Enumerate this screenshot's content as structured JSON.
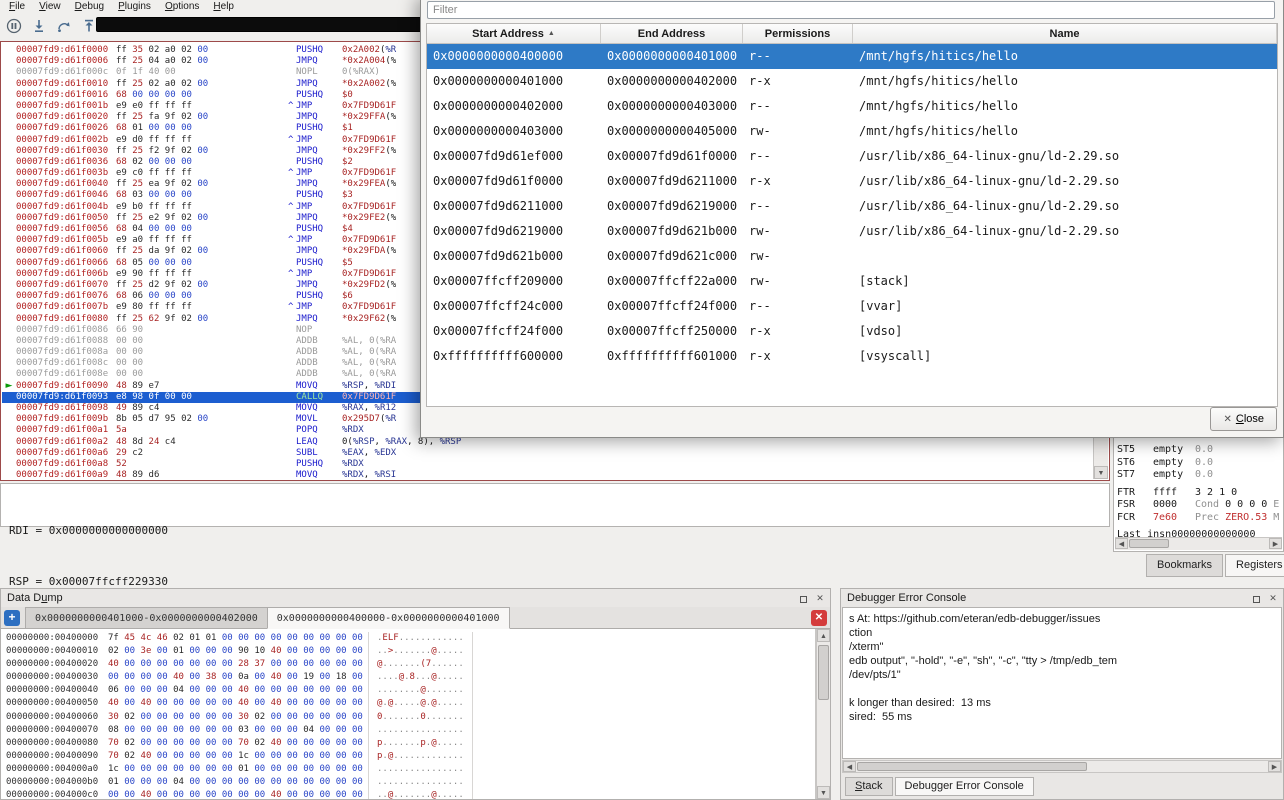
{
  "menu": {
    "items": [
      {
        "label": "File",
        "accel": 0
      },
      {
        "label": "View",
        "accel": 0
      },
      {
        "label": "Debug",
        "accel": 0
      },
      {
        "label": "Plugins",
        "accel": 0
      },
      {
        "label": "Options",
        "accel": 0
      },
      {
        "label": "Help",
        "accel": 0
      }
    ]
  },
  "toolbar": {
    "buttons": [
      {
        "icon": "pause-icon"
      },
      {
        "icon": "step-into-icon"
      },
      {
        "icon": "step-over-icon"
      },
      {
        "icon": "step-out-icon"
      },
      {
        "icon": "run-icon"
      }
    ],
    "args_value": ""
  },
  "disassembly": {
    "rows": [
      [
        "00007fd9:d61f0000",
        "ff 35 02 a0 02 00",
        0,
        "PUSHQ",
        "0x2A002(%R",
        ""
      ],
      [
        "00007fd9:d61f0006",
        "ff 25 04 a0 02 00",
        0,
        "JMPQ",
        "*0x2A004(%",
        ""
      ],
      [
        "00007fd9:d61f000c",
        "0f 1f 40 00",
        0,
        "NOPL",
        "0(%RAX)",
        "gray"
      ],
      [
        "00007fd9:d61f0010",
        "ff 25 02 a0 02 00",
        0,
        "JMPQ",
        "*0x2A002(%",
        ""
      ],
      [
        "00007fd9:d61f0016",
        "68 00 00 00 00",
        0,
        "PUSHQ",
        "$0",
        ""
      ],
      [
        "00007fd9:d61f001b",
        "e9 e0 ff ff ff",
        1,
        "JMP",
        "0x7FD9D61F",
        ""
      ],
      [
        "00007fd9:d61f0020",
        "ff 25 fa 9f 02 00",
        0,
        "JMPQ",
        "*0x29FFA(%",
        ""
      ],
      [
        "00007fd9:d61f0026",
        "68 01 00 00 00",
        0,
        "PUSHQ",
        "$1",
        ""
      ],
      [
        "00007fd9:d61f002b",
        "e9 d0 ff ff ff",
        1,
        "JMP",
        "0x7FD9D61F",
        ""
      ],
      [
        "00007fd9:d61f0030",
        "ff 25 f2 9f 02 00",
        0,
        "JMPQ",
        "*0x29FF2(%",
        ""
      ],
      [
        "00007fd9:d61f0036",
        "68 02 00 00 00",
        0,
        "PUSHQ",
        "$2",
        ""
      ],
      [
        "00007fd9:d61f003b",
        "e9 c0 ff ff ff",
        1,
        "JMP",
        "0x7FD9D61F",
        ""
      ],
      [
        "00007fd9:d61f0040",
        "ff 25 ea 9f 02 00",
        0,
        "JMPQ",
        "*0x29FEA(%",
        ""
      ],
      [
        "00007fd9:d61f0046",
        "68 03 00 00 00",
        0,
        "PUSHQ",
        "$3",
        ""
      ],
      [
        "00007fd9:d61f004b",
        "e9 b0 ff ff ff",
        1,
        "JMP",
        "0x7FD9D61F",
        ""
      ],
      [
        "00007fd9:d61f0050",
        "ff 25 e2 9f 02 00",
        0,
        "JMPQ",
        "*0x29FE2(%",
        ""
      ],
      [
        "00007fd9:d61f0056",
        "68 04 00 00 00",
        0,
        "PUSHQ",
        "$4",
        ""
      ],
      [
        "00007fd9:d61f005b",
        "e9 a0 ff ff ff",
        1,
        "JMP",
        "0x7FD9D61F",
        ""
      ],
      [
        "00007fd9:d61f0060",
        "ff 25 da 9f 02 00",
        0,
        "JMPQ",
        "*0x29FDA(%",
        ""
      ],
      [
        "00007fd9:d61f0066",
        "68 05 00 00 00",
        0,
        "PUSHQ",
        "$5",
        ""
      ],
      [
        "00007fd9:d61f006b",
        "e9 90 ff ff ff",
        1,
        "JMP",
        "0x7FD9D61F",
        ""
      ],
      [
        "00007fd9:d61f0070",
        "ff 25 d2 9f 02 00",
        0,
        "JMPQ",
        "*0x29FD2(%",
        ""
      ],
      [
        "00007fd9:d61f0076",
        "68 06 00 00 00",
        0,
        "PUSHQ",
        "$6",
        ""
      ],
      [
        "00007fd9:d61f007b",
        "e9 80 ff ff ff",
        1,
        "JMP",
        "0x7FD9D61F",
        ""
      ],
      [
        "00007fd9:d61f0080",
        "ff 25 62 9f 02 00",
        0,
        "JMPQ",
        "*0x29F62(%",
        ""
      ],
      [
        "00007fd9:d61f0086",
        "66 90",
        0,
        "NOP",
        "",
        "gray"
      ],
      [
        "00007fd9:d61f0088",
        "00 00",
        0,
        "ADDB",
        "%AL, 0(%RA",
        "gray"
      ],
      [
        "00007fd9:d61f008a",
        "00 00",
        0,
        "ADDB",
        "%AL, 0(%RA",
        "gray"
      ],
      [
        "00007fd9:d61f008c",
        "00 00",
        0,
        "ADDB",
        "%AL, 0(%RA",
        "gray"
      ],
      [
        "00007fd9:d61f008e",
        "00 00",
        0,
        "ADDB",
        "%AL, 0(%RA",
        "gray"
      ],
      [
        "00007fd9:d61f0090",
        "48 89 e7",
        0,
        "MOVQ",
        "%RSP, %RDI",
        "current"
      ],
      [
        "00007fd9:d61f0093",
        "e8 98 0f 00 00",
        0,
        "CALLQ",
        "0x7FD9D61F",
        "selected"
      ],
      [
        "00007fd9:d61f0098",
        "49 89 c4",
        0,
        "MOVQ",
        "%RAX, %R12",
        ""
      ],
      [
        "00007fd9:d61f009b",
        "8b 05 d7 95 02 00",
        0,
        "MOVL",
        "0x295D7(%R",
        ""
      ],
      [
        "00007fd9:d61f00a1",
        "5a",
        0,
        "POPQ",
        "%RDX",
        ""
      ],
      [
        "00007fd9:d61f00a2",
        "48 8d 24 c4",
        0,
        "LEAQ",
        "0(%RSP, %RAX, 8), %RSP",
        ""
      ],
      [
        "00007fd9:d61f00a6",
        "29 c2",
        0,
        "SUBL",
        "%EAX, %EDX",
        ""
      ],
      [
        "00007fd9:d61f00a8",
        "52",
        0,
        "PUSHQ",
        "%RDX",
        ""
      ],
      [
        "00007fd9:d61f00a9",
        "48 89 d6",
        0,
        "MOVQ",
        "%RDX, %RSI",
        ""
      ]
    ]
  },
  "info_pane": {
    "lines": [
      "RDI = 0x0000000000000000",
      "RSP = 0x00007ffcff229330"
    ]
  },
  "regions_dialog": {
    "filter_placeholder": "Filter",
    "columns": [
      "Start Address",
      "End Address",
      "Permissions",
      "Name"
    ],
    "sort_column": 0,
    "sort_order": "ascending",
    "rows": [
      {
        "start": "0x0000000000400000",
        "end": "0x0000000000401000",
        "perm": "r--",
        "name": "/mnt/hgfs/hitics/hello",
        "selected": true
      },
      {
        "start": "0x0000000000401000",
        "end": "0x0000000000402000",
        "perm": "r-x",
        "name": "/mnt/hgfs/hitics/hello",
        "selected": false
      },
      {
        "start": "0x0000000000402000",
        "end": "0x0000000000403000",
        "perm": "r--",
        "name": "/mnt/hgfs/hitics/hello",
        "selected": false
      },
      {
        "start": "0x0000000000403000",
        "end": "0x0000000000405000",
        "perm": "rw-",
        "name": "/mnt/hgfs/hitics/hello",
        "selected": false
      },
      {
        "start": "0x00007fd9d61ef000",
        "end": "0x00007fd9d61f0000",
        "perm": "r--",
        "name": "/usr/lib/x86_64-linux-gnu/ld-2.29.so",
        "selected": false
      },
      {
        "start": "0x00007fd9d61f0000",
        "end": "0x00007fd9d6211000",
        "perm": "r-x",
        "name": "/usr/lib/x86_64-linux-gnu/ld-2.29.so",
        "selected": false
      },
      {
        "start": "0x00007fd9d6211000",
        "end": "0x00007fd9d6219000",
        "perm": "r--",
        "name": "/usr/lib/x86_64-linux-gnu/ld-2.29.so",
        "selected": false
      },
      {
        "start": "0x00007fd9d6219000",
        "end": "0x00007fd9d621b000",
        "perm": "rw-",
        "name": "/usr/lib/x86_64-linux-gnu/ld-2.29.so",
        "selected": false
      },
      {
        "start": "0x00007fd9d621b000",
        "end": "0x00007fd9d621c000",
        "perm": "rw-",
        "name": "",
        "selected": false
      },
      {
        "start": "0x00007ffcff209000",
        "end": "0x00007ffcff22a000",
        "perm": "rw-",
        "name": "[stack]",
        "selected": false
      },
      {
        "start": "0x00007ffcff24c000",
        "end": "0x00007ffcff24f000",
        "perm": "r--",
        "name": "[vvar]",
        "selected": false
      },
      {
        "start": "0x00007ffcff24f000",
        "end": "0x00007ffcff250000",
        "perm": "r-x",
        "name": "[vdso]",
        "selected": false
      },
      {
        "start": "0xffffffffff600000",
        "end": "0xffffffffff601000",
        "perm": "r-x",
        "name": "[vsyscall]",
        "selected": false
      }
    ],
    "close_button": {
      "label": "Close",
      "accel": 0,
      "icon": "close-x-icon"
    }
  },
  "registers_panel": {
    "rows": [
      {
        "name": "ST5",
        "value": "empty",
        "extra": [
          {
            "t": "0.0",
            "c": "dim"
          }
        ]
      },
      {
        "name": "ST6",
        "value": "empty",
        "extra": [
          {
            "t": "0.0",
            "c": "dim"
          }
        ]
      },
      {
        "name": "ST7",
        "value": "empty",
        "extra": [
          {
            "t": "0.0",
            "c": "dim"
          }
        ]
      },
      {
        "name": "FTR",
        "value": "ffff",
        "extra": [
          {
            "t": "3 2 1 0",
            "c": ""
          }
        ],
        "gap": true
      },
      {
        "name": "FSR",
        "value": "0000",
        "extra": [
          {
            "t": "Cond ",
            "c": "dim"
          },
          {
            "t": "0 0 0 0",
            "c": ""
          },
          {
            "t": " E",
            "c": "dim"
          }
        ]
      },
      {
        "name": "FCR",
        "value": "7e60",
        "valueColor": "red",
        "extra": [
          {
            "t": "Prec ",
            "c": "dim"
          },
          {
            "t": "ZERO.53",
            "c": "red"
          },
          {
            "t": " M",
            "c": "dim"
          }
        ]
      },
      {
        "name": "Last insn",
        "value": "00000000000000",
        "gap": true
      }
    ],
    "tabs": [
      {
        "label": "Bookmarks",
        "active": false
      },
      {
        "label": "Registers",
        "active": true
      }
    ]
  },
  "data_dump": {
    "title": {
      "label": "Data Dump",
      "accel": 6
    },
    "tabs": [
      {
        "label": "0x0000000000401000-0x0000000000402000",
        "active": false
      },
      {
        "label": "0x0000000000400000-0x0000000000401000",
        "active": true
      }
    ],
    "rows": [
      {
        "addr": "00000000:00400000",
        "bytes": "7f 45 4c 46 02 01 01 00 00 00 00 00 00 00 00 00",
        "ascii": ".ELF............"
      },
      {
        "addr": "00000000:00400010",
        "bytes": "02 00 3e 00 01 00 00 00 90 10 40 00 00 00 00 00",
        "ascii": "..>.......@....."
      },
      {
        "addr": "00000000:00400020",
        "bytes": "40 00 00 00 00 00 00 00 28 37 00 00 00 00 00 00",
        "ascii": "@.......(7......"
      },
      {
        "addr": "00000000:00400030",
        "bytes": "00 00 00 00 40 00 38 00 0a 00 40 00 19 00 18 00",
        "ascii": "....@.8...@....."
      },
      {
        "addr": "00000000:00400040",
        "bytes": "06 00 00 00 04 00 00 00 40 00 00 00 00 00 00 00",
        "ascii": "........@......."
      },
      {
        "addr": "00000000:00400050",
        "bytes": "40 00 40 00 00 00 00 00 40 00 40 00 00 00 00 00",
        "ascii": "@.@.....@.@....."
      },
      {
        "addr": "00000000:00400060",
        "bytes": "30 02 00 00 00 00 00 00 30 02 00 00 00 00 00 00",
        "ascii": "0.......0......."
      },
      {
        "addr": "00000000:00400070",
        "bytes": "08 00 00 00 00 00 00 00 03 00 00 00 04 00 00 00",
        "ascii": "................"
      },
      {
        "addr": "00000000:00400080",
        "bytes": "70 02 00 00 00 00 00 00 70 02 40 00 00 00 00 00",
        "ascii": "p.......p.@....."
      },
      {
        "addr": "00000000:00400090",
        "bytes": "70 02 40 00 00 00 00 00 1c 00 00 00 00 00 00 00",
        "ascii": "p.@............."
      },
      {
        "addr": "00000000:004000a0",
        "bytes": "1c 00 00 00 00 00 00 00 01 00 00 00 00 00 00 00",
        "ascii": "................"
      },
      {
        "addr": "00000000:004000b0",
        "bytes": "01 00 00 00 04 00 00 00 00 00 00 00 00 00 00 00",
        "ascii": "................"
      },
      {
        "addr": "00000000:004000c0",
        "bytes": "00 00 40 00 00 00 00 00 00 00 40 00 00 00 00 00",
        "ascii": "..@.......@....."
      }
    ]
  },
  "error_console": {
    "title": "Debugger Error Console",
    "lines": [
      "s At: https://github.com/eteran/edb-debugger/issues",
      "ction",
      "/xterm\"",
      "edb output\", \"-hold\", \"-e\", \"sh\", \"-c\", \"tty > /tmp/edb_tem",
      "/dev/pts/1\"",
      "",
      "k longer than desired:  13 ms",
      "sired:  55 ms"
    ],
    "tabs": [
      {
        "label": "Stack",
        "accel": 0,
        "active": false
      },
      {
        "label": "Debugger Error Console",
        "active": true
      }
    ]
  },
  "colors": {
    "table_selection": "#2e7ac6",
    "disasm_selection": "#1c5ed0",
    "address_red": "#b22222",
    "mnemonic_blue": "#1a1acc",
    "zero_byte_blue": "#2a46c8",
    "printable_byte_red": "#a82424",
    "current_arrow_green": "#0a9a0a",
    "add_tab_blue": "#2d6fc1",
    "close_tab_red": "#d43c3c"
  }
}
